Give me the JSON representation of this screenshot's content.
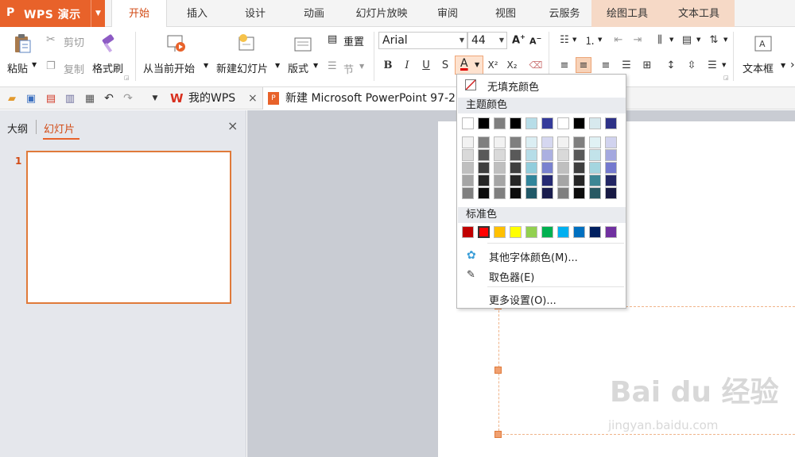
{
  "app": {
    "logo": "P",
    "title": "WPS 演示"
  },
  "tabs": [
    {
      "label": "开始",
      "active": true
    },
    {
      "label": "插入"
    },
    {
      "label": "设计"
    },
    {
      "label": "动画"
    },
    {
      "label": "幻灯片放映"
    },
    {
      "label": "审阅"
    },
    {
      "label": "视图"
    },
    {
      "label": "云服务"
    },
    {
      "label": "绘图工具",
      "context": true
    },
    {
      "label": "文本工具",
      "context": true
    }
  ],
  "ribbon": {
    "paste_label": "粘贴",
    "cut_label": "剪切",
    "copy_label": "复制",
    "format_painter_label": "格式刷",
    "from_current_label": "从当前开始",
    "new_slide_label": "新建幻灯片",
    "layout_label": "版式",
    "reset_label": "重置",
    "section_label": "节",
    "font_name": "Arial",
    "font_size": "44",
    "bold": "B",
    "italic": "I",
    "underline": "U",
    "strike": "S",
    "font_color": "A",
    "superscript": "X²",
    "subscript": "X₂",
    "textbox_label": "文本框",
    "more_arrow": "›"
  },
  "quick_access": {
    "doc_tabs": [
      {
        "label": "我的WPS",
        "close": "×"
      },
      {
        "label": "新建 Microsoft PowerPoint 97-2"
      }
    ]
  },
  "left_panel": {
    "tab_outline": "大纲",
    "tab_slides": "幻灯片",
    "close": "×",
    "slide_number": "1"
  },
  "color_menu": {
    "no_fill": "无填充颜色",
    "theme_colors_title": "主题颜色",
    "standard_colors_title": "标准色",
    "more_colors": "其他字体颜色(M)...",
    "eyedropper": "取色器(E)",
    "more_settings": "更多设置(O)...",
    "theme_top_row": [
      "#ffffff",
      "#000000",
      "#7f7f7f",
      "#000000",
      "#b7dde8",
      "#353b9a",
      "#ffffff",
      "#000000",
      "#d7e9ee",
      "#2e3287"
    ],
    "theme_shades": [
      [
        "#f2f2f2",
        "#7f7f7f",
        "#f2f2f2",
        "#7f7f7f",
        "#dbeef3",
        "#d5d7f0",
        "#f2f2f2",
        "#7f7f7f",
        "#e0f1f4",
        "#d1d3ef"
      ],
      [
        "#d9d9d9",
        "#595959",
        "#d9d9d9",
        "#595959",
        "#b6dde8",
        "#abb0e1",
        "#d9d9d9",
        "#595959",
        "#c2e3ea",
        "#a4a8df"
      ],
      [
        "#bfbfbf",
        "#3f3f3f",
        "#bfbfbf",
        "#3f3f3f",
        "#92cddc",
        "#7a82cf",
        "#bfbfbf",
        "#3f3f3f",
        "#a4d5df",
        "#7479ce"
      ],
      [
        "#a5a5a5",
        "#262626",
        "#a5a5a5",
        "#262626",
        "#31859b",
        "#262a73",
        "#a5a5a5",
        "#262626",
        "#3c8694",
        "#232664"
      ],
      [
        "#7f7f7f",
        "#0c0c0c",
        "#7f7f7f",
        "#0c0c0c",
        "#205867",
        "#191c4d",
        "#7f7f7f",
        "#0c0c0c",
        "#285963",
        "#171943"
      ]
    ],
    "standard_colors": [
      "#c00000",
      "#ff0000",
      "#ffc000",
      "#ffff00",
      "#92d050",
      "#00b050",
      "#00b0f0",
      "#0070c0",
      "#002060",
      "#7030a0"
    ],
    "selected_standard_index": 1
  },
  "watermark": {
    "brand": "Bai du 经验",
    "url": "jingyan.baidu.com"
  }
}
